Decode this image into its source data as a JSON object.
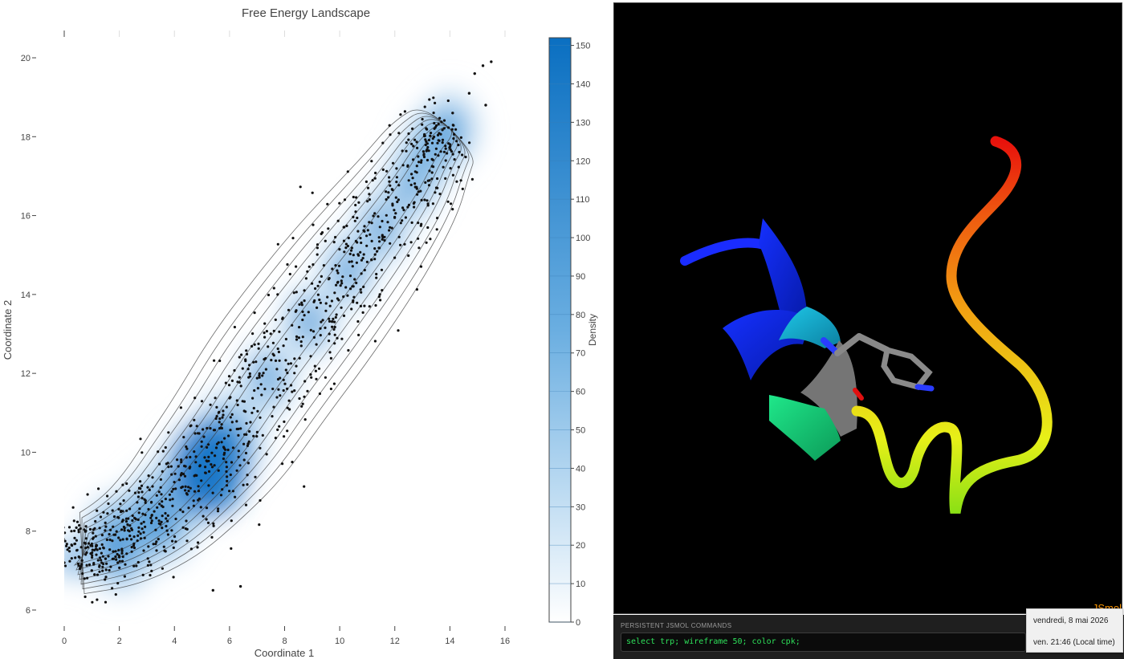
{
  "plot": {
    "title": "Free Energy Landscape",
    "colorbar_label": "Density"
  },
  "chart_data": {
    "type": "scatter",
    "title": "Free Energy Landscape",
    "xlabel": "Coordinate 1",
    "ylabel": "Coordinate 2",
    "xlim": [
      -1,
      17
    ],
    "ylim": [
      5.6,
      20.6
    ],
    "x_ticks": [
      0,
      2,
      4,
      6,
      8,
      10,
      12,
      14,
      16
    ],
    "y_ticks": [
      6,
      8,
      10,
      12,
      14,
      16,
      18,
      20
    ],
    "colorbar": {
      "label": "Density",
      "range": [
        0,
        152
      ],
      "ticks": [
        0,
        10,
        20,
        30,
        40,
        50,
        60,
        70,
        80,
        90,
        100,
        110,
        120,
        130,
        140,
        150
      ]
    },
    "overlay": "2D density heatmap (blues) with contour lines and scatter points",
    "density_peak": {
      "x": 5.3,
      "y": 9.6
    },
    "ridge": [
      [
        0.3,
        7.3
      ],
      [
        2,
        7.7
      ],
      [
        3.5,
        8.4
      ],
      [
        4.8,
        9.4
      ],
      [
        6,
        10.4
      ],
      [
        7.4,
        11.9
      ],
      [
        8.9,
        13.3
      ],
      [
        10.3,
        14.6
      ],
      [
        11.5,
        15.7
      ],
      [
        12.6,
        16.8
      ],
      [
        13.3,
        17.7
      ],
      [
        14,
        18.2
      ]
    ],
    "outlier_points": [
      [
        0,
        7.2
      ],
      [
        0.6,
        7.1
      ],
      [
        1,
        7.0
      ],
      [
        1.1,
        6.9
      ],
      [
        1.5,
        7.3
      ],
      [
        2.1,
        7.5
      ],
      [
        5.4,
        6.5
      ],
      [
        6.4,
        6.6
      ],
      [
        14.1,
        18.6
      ],
      [
        14.7,
        19.1
      ],
      [
        14.9,
        19.6
      ],
      [
        15.2,
        19.8
      ],
      [
        15.5,
        19.9
      ],
      [
        15.3,
        18.8
      ]
    ]
  },
  "jsmol": {
    "logo": "JSmol",
    "commands_title": "PERSISTENT JSMOL COMMANDS",
    "command": "select trp; wireframe 50; color cpk;",
    "colors": {
      "background": "#000000",
      "blue": "#0a1eff",
      "cyan": "#13b8d8",
      "green": "#19e62a",
      "yellow": "#f2f20d",
      "orange": "#f07a0d",
      "red": "#ef1a0d",
      "ring": "#8c8c8c"
    }
  },
  "tooltip": {
    "date": "vendredi, 8 mai 2026",
    "time": "ven. 21:46 (Local time)"
  }
}
